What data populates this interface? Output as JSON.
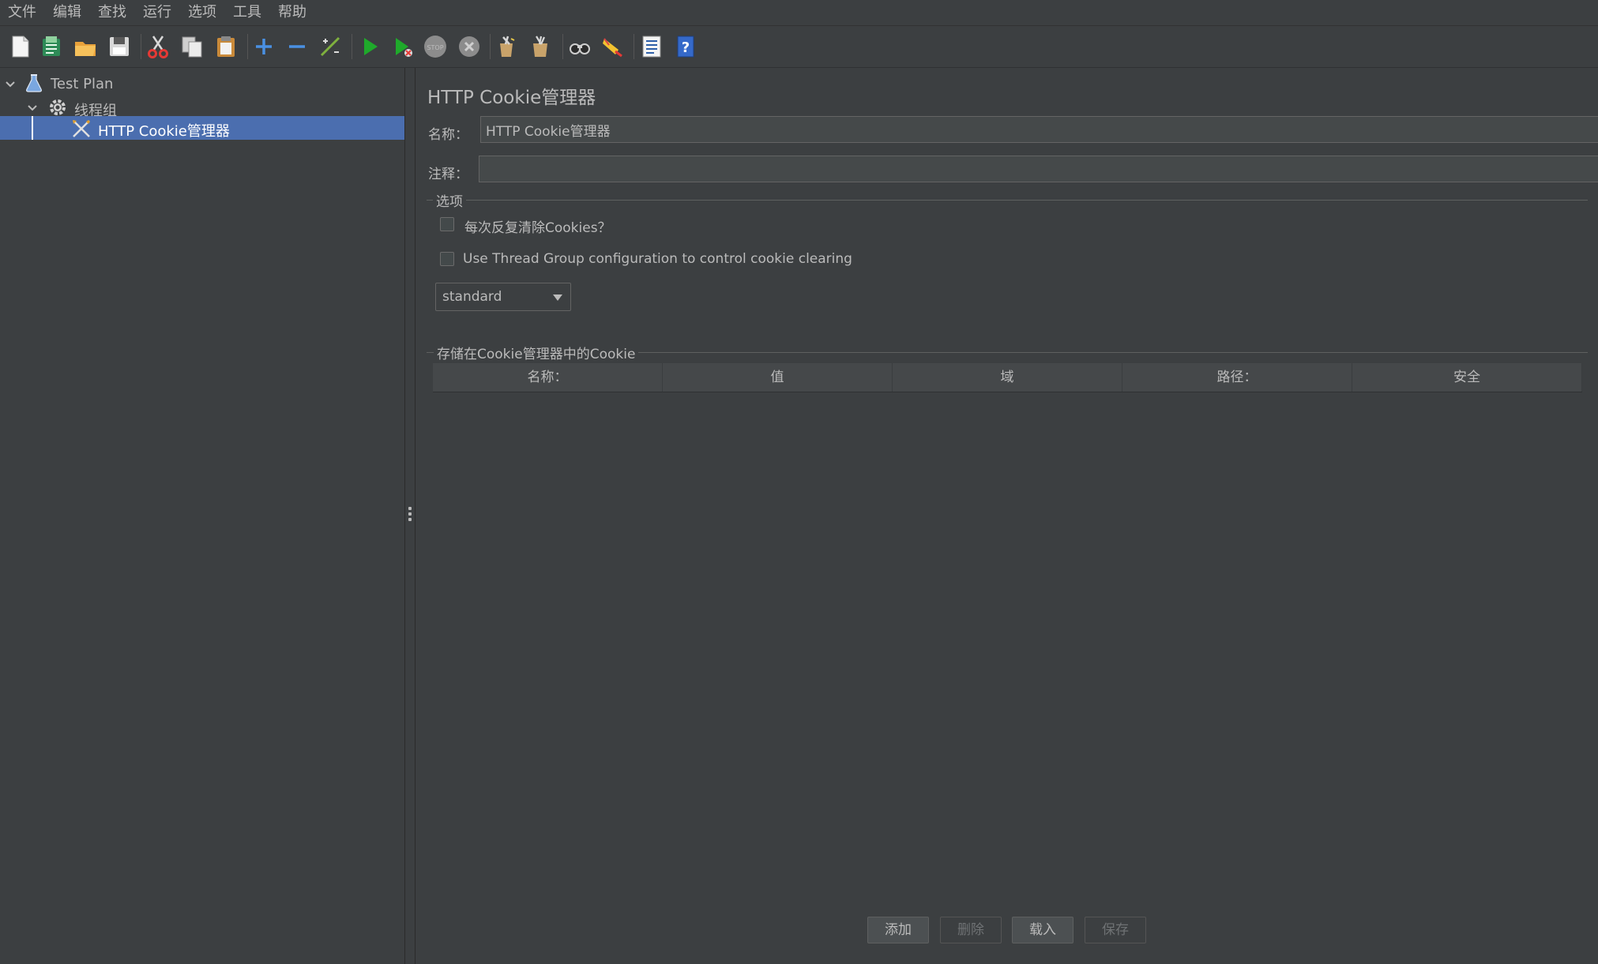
{
  "menu": [
    "文件",
    "编辑",
    "查找",
    "运行",
    "选项",
    "工具",
    "帮助"
  ],
  "toolbar": {
    "icons": [
      "new-icon",
      "templates-icon",
      "open-icon",
      "save-icon",
      "cut-icon",
      "copy-icon",
      "paste-icon",
      "expand-icon",
      "collapse-icon",
      "toggle-icon",
      "start-icon",
      "start-no-pause-icon",
      "stop-icon",
      "shutdown-icon",
      "clear-icon",
      "clear-all-icon",
      "search-icon",
      "reset-search-icon",
      "function-helper-icon",
      "help-icon"
    ]
  },
  "tree": {
    "items": [
      {
        "label": "Test Plan",
        "icon": "flask-icon",
        "expanded": true
      },
      {
        "label": "线程组",
        "icon": "gear-icon",
        "expanded": true
      },
      {
        "label": "HTTP Cookie管理器",
        "icon": "tools-icon",
        "selected": true
      }
    ]
  },
  "panel": {
    "title": "HTTP Cookie管理器",
    "name_label": "名称：",
    "name_value": "HTTP Cookie管理器",
    "comment_label": "注释：",
    "comment_value": "",
    "options_title": "选项",
    "clear_each_iteration_label": "每次反复清除Cookies？",
    "clear_each_iteration_checked": false,
    "use_thread_group_label": "Use Thread Group configuration to control cookie clearing",
    "use_thread_group_checked": false,
    "policy_value": "standard",
    "stored_title": "存储在Cookie管理器中的Cookie",
    "columns": [
      "名称：",
      "值",
      "域",
      "路径：",
      "安全"
    ],
    "buttons": {
      "add": "添加",
      "delete": "删除",
      "load": "载入",
      "save": "保存"
    }
  },
  "colors": {
    "background": "#3c3f41",
    "selection": "#4b6eaf",
    "text": "#bbbbbb"
  }
}
